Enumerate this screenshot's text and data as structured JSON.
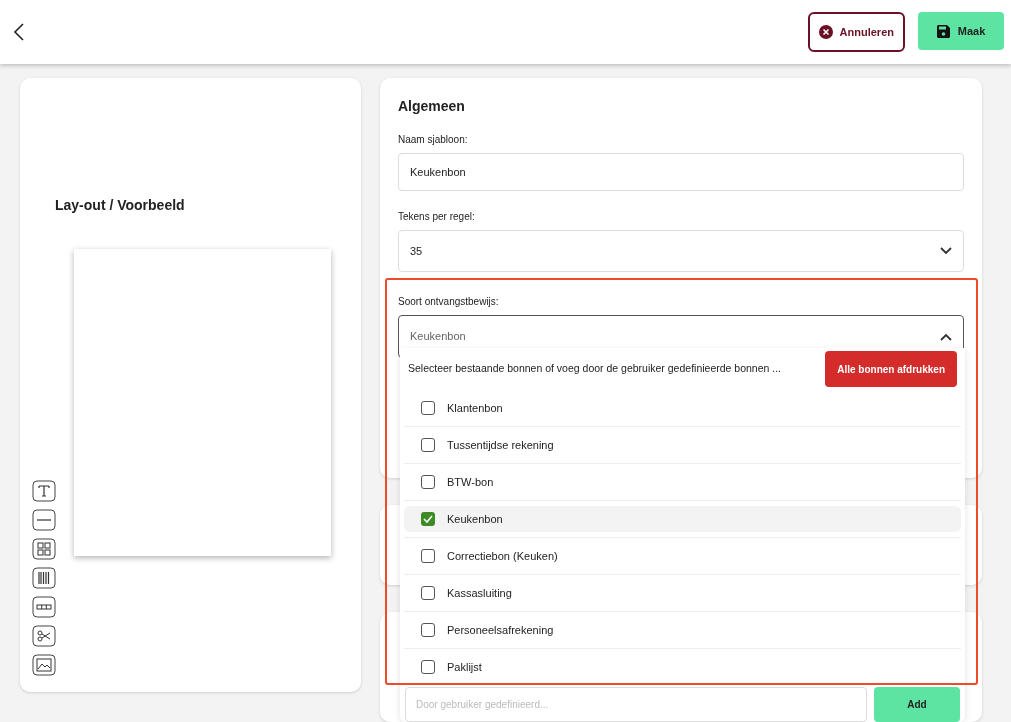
{
  "header": {
    "cancel_button": "Annuleren",
    "make_button": "Maak"
  },
  "preview": {
    "title": "Lay-out / Voorbeeld"
  },
  "general": {
    "title": "Algemeen",
    "template_name": {
      "label": "Naam sjabloon:",
      "value": "Keukenbon"
    },
    "chars_per_line": {
      "label": "Tekens per regel:",
      "value": "35"
    },
    "receipt_type": {
      "label": "Soort ontvangstbewijs:",
      "value": "Keukenbon",
      "expanded": true
    }
  },
  "dropdown": {
    "hint": "Selecteer bestaande bonnen of voeg door de gebruiker gedefinieerde bonnen ...",
    "print_all_button": "Alle bonnen afdrukken",
    "options": [
      {
        "label": "Klantenbon",
        "checked": false
      },
      {
        "label": "Tussentijdse rekening",
        "checked": false
      },
      {
        "label": "BTW-bon",
        "checked": false
      },
      {
        "label": "Keukenbon",
        "checked": true
      },
      {
        "label": "Correctiebon (Keuken)",
        "checked": false
      },
      {
        "label": "Kassasluiting",
        "checked": false
      },
      {
        "label": "Personeelsafrekening",
        "checked": false
      },
      {
        "label": "Paklijst",
        "checked": false
      }
    ],
    "custom": {
      "placeholder": "Door gebruiker gedefinieerd..."
    },
    "add_button": "Add"
  }
}
